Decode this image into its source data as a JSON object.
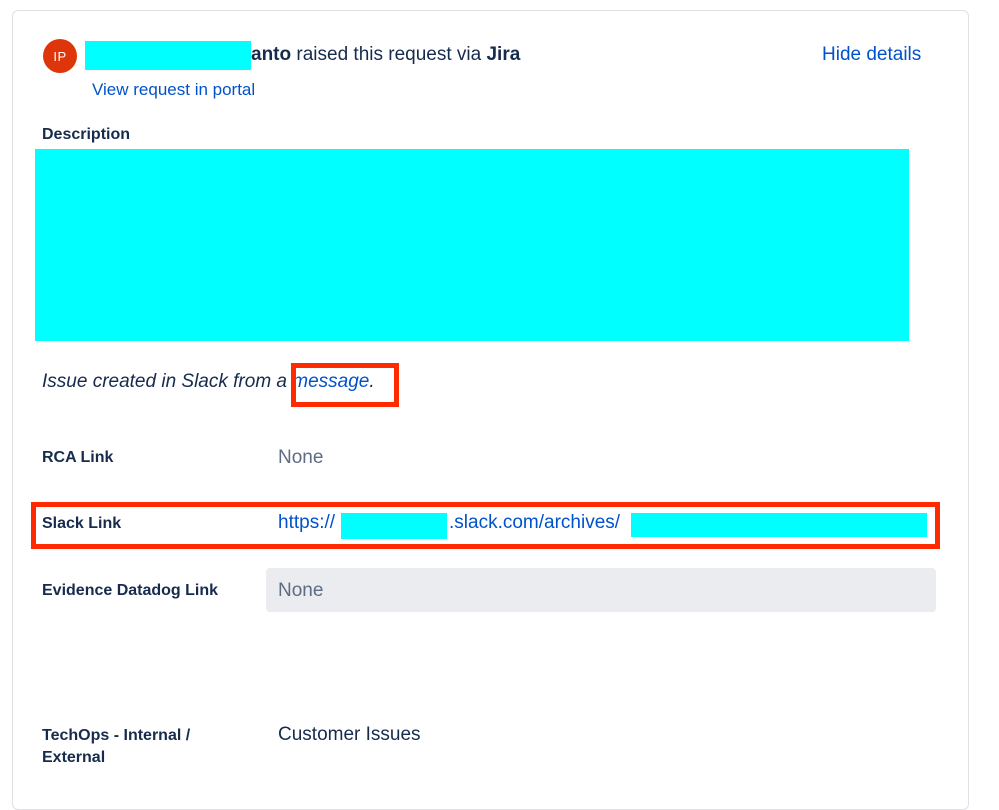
{
  "header": {
    "avatar_initials": "IP",
    "reporter_suffix": "anto",
    "raised_text": " raised this request via ",
    "channel": "Jira",
    "hide_details_label": "Hide details",
    "view_portal_label": "View request in portal"
  },
  "description": {
    "label": "Description",
    "issue_note_prefix": "Issue created in Slack from a ",
    "issue_note_link": "message",
    "issue_note_suffix": "."
  },
  "fields": {
    "rca_link": {
      "label": "RCA Link",
      "value": "None"
    },
    "slack_link": {
      "label": "Slack Link",
      "url_prefix": "https://",
      "url_middle": ".slack.com/archives/"
    },
    "evidence_datadog_link": {
      "label": "Evidence Datadog Link",
      "value": "None"
    },
    "techops": {
      "label_line1": "TechOps - Internal /",
      "label_line2": "External",
      "value": "Customer Issues"
    }
  },
  "colors": {
    "link": "#0052cc",
    "redaction": "#00ffff",
    "highlight_box": "#ff2a00",
    "avatar_bg": "#de350b"
  }
}
